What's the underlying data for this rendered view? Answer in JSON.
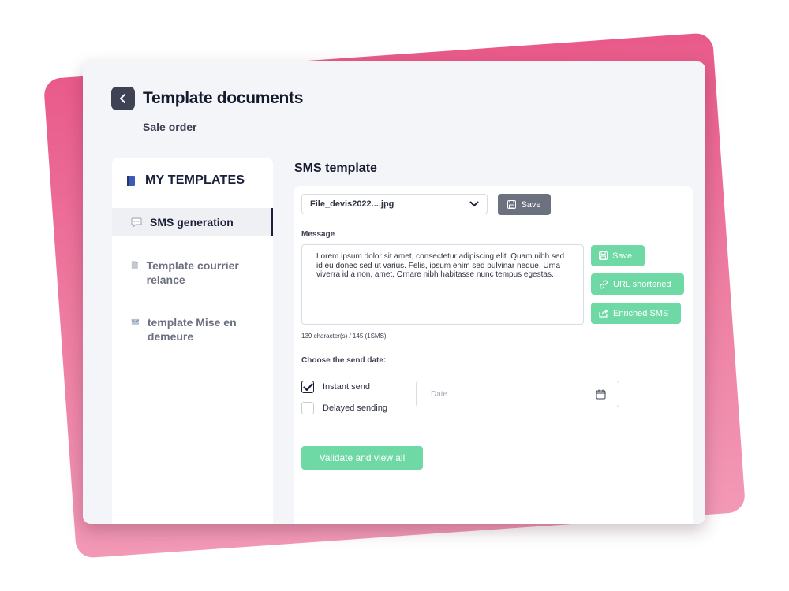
{
  "header": {
    "title": "Template documents",
    "subtitle": "Sale order"
  },
  "sidebar": {
    "heading": "MY TEMPLATES",
    "items": [
      {
        "label": "SMS generation",
        "icon": "speech-bubble-icon",
        "active": true
      },
      {
        "label": "Template courrier relance",
        "icon": "document-icon",
        "active": false
      },
      {
        "label": "template Mise en demeure",
        "icon": "envelope-icon",
        "active": false
      }
    ]
  },
  "main": {
    "title": "SMS template",
    "file_select": {
      "value": "File_devis2022....jpg"
    },
    "save_top_label": "Save",
    "message_label": "Message",
    "message_text": "Lorem ipsum dolor sit amet, consectetur adipiscing elit. Quam nibh sed id eu donec sed ut varius. Felis, ipsum enim sed pulvinar neque. Urna viverra id a non, amet. Ornare nibh habitasse nunc tempus egestas.",
    "actions": {
      "save_label": "Save",
      "url_label": "URL shortened",
      "enriched_label": "Enriched SMS"
    },
    "counter": "139 character(s) / 145 (1SMS)",
    "send_date_label": "Choose the send date:",
    "options": {
      "instant": {
        "label": "Instant send",
        "checked": true
      },
      "delayed": {
        "label": "Delayed sending",
        "checked": false
      }
    },
    "date_placeholder": "Date",
    "validate_label": "Validate and view all"
  },
  "colors": {
    "accent_green": "#6fd9a6",
    "dark_navy": "#1b1f3b",
    "pink": "#e95a8a",
    "gray_button": "#6c717f"
  }
}
